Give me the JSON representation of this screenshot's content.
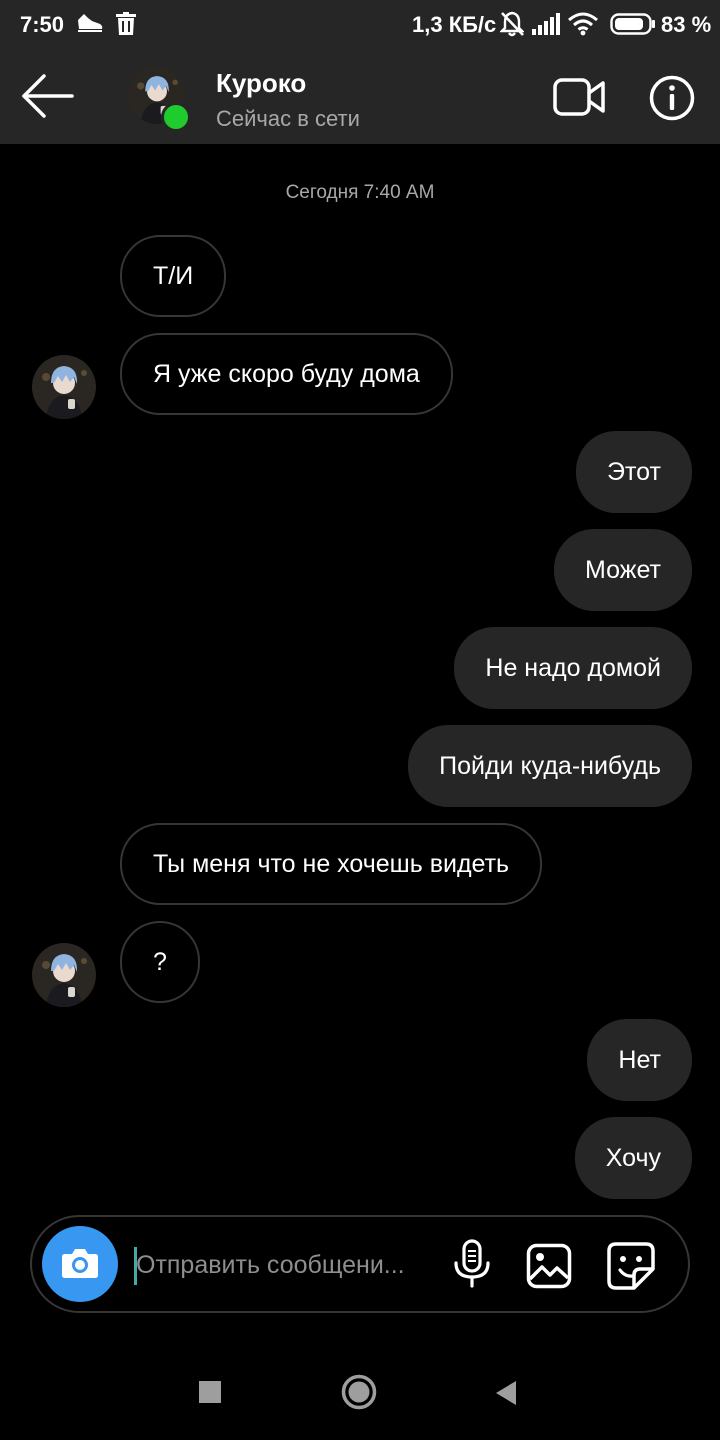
{
  "status_bar": {
    "time": "7:50",
    "network_speed": "1,3 КБ/с",
    "battery": "83 %"
  },
  "header": {
    "contact_name": "Куроко",
    "contact_status": "Сейчас в сети",
    "online_color": "#1fcc2e"
  },
  "chat": {
    "date": "Сегодня 7:40 AM",
    "messages": [
      {
        "from": "them",
        "text": "Т/И"
      },
      {
        "from": "them",
        "text": "Я уже скоро буду дома"
      },
      {
        "from": "me",
        "text": "Этот"
      },
      {
        "from": "me",
        "text": "Может"
      },
      {
        "from": "me",
        "text": "Не надо домой"
      },
      {
        "from": "me",
        "text": "Пойди куда-нибудь"
      },
      {
        "from": "them",
        "text": "Ты меня что не хочешь видеть"
      },
      {
        "from": "them",
        "text": "?"
      },
      {
        "from": "me",
        "text": "Нет"
      },
      {
        "from": "me",
        "text": "Хочу"
      }
    ]
  },
  "composer": {
    "placeholder": "Отправить сообщени...",
    "camera_color": "#3897f0"
  },
  "icons": {
    "status": [
      "sneaker-icon",
      "trash-icon",
      "muted-bell-icon",
      "signal-icon",
      "wifi-icon",
      "battery-icon"
    ],
    "header": [
      "back-arrow-icon",
      "video-camera-icon",
      "info-icon"
    ],
    "composer": [
      "camera-icon",
      "microphone-icon",
      "gallery-icon",
      "sticker-icon"
    ],
    "nav": [
      "recents-square-icon",
      "home-circle-icon",
      "back-triangle-icon"
    ]
  }
}
